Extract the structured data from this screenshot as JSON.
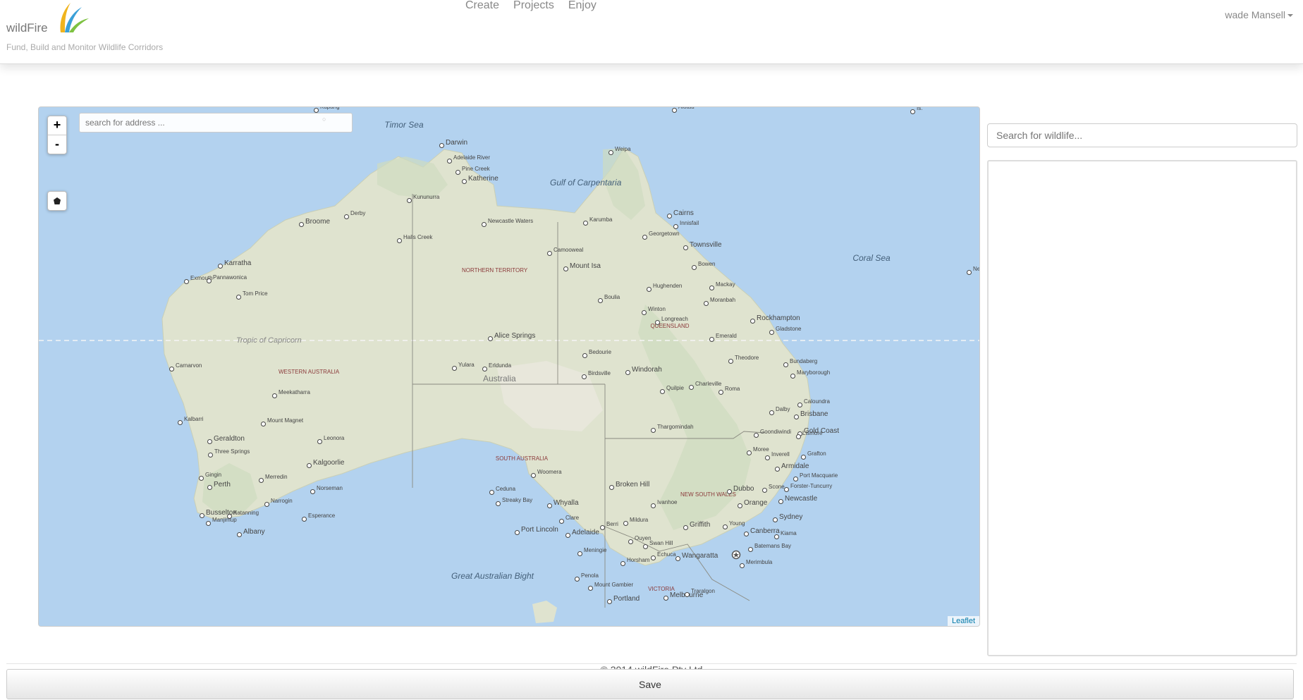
{
  "header": {
    "brand": "wildFire",
    "tagline": "Fund, Build and Monitor Wildlife Corridors",
    "nav": [
      "Create",
      "Projects",
      "Enjoy"
    ],
    "user": "wade Mansell"
  },
  "map": {
    "zoom_in": "+",
    "zoom_out": "-",
    "address_placeholder": "search for address ...",
    "attribution": "Leaflet",
    "country": "Australia",
    "tropic": "Tropic of Capricorn",
    "seas": [
      "Timor Sea",
      "Gulf of Carpentaria",
      "Coral Sea",
      "Great Australian Bight"
    ],
    "states": [
      "NORTHERN TERRITORY",
      "QUEENSLAND",
      "WESTERN AUSTRALIA",
      "SOUTH AUSTRALIA",
      "NEW SOUTH WALES",
      "VICTORIA"
    ],
    "cities": [
      {
        "name": "Darwin",
        "big": true
      },
      {
        "name": "Adelaide River"
      },
      {
        "name": "Pine Creek"
      },
      {
        "name": "Katherine",
        "big": true
      },
      {
        "name": "Kununurra"
      },
      {
        "name": "Derby"
      },
      {
        "name": "Broome",
        "big": true
      },
      {
        "name": "Halls Creek"
      },
      {
        "name": "Newcastle Waters"
      },
      {
        "name": "Karratha",
        "big": true
      },
      {
        "name": "Exmouth"
      },
      {
        "name": "Pannawonica"
      },
      {
        "name": "Tom Price"
      },
      {
        "name": "Camooweal"
      },
      {
        "name": "Mount Isa",
        "big": true
      },
      {
        "name": "Karumba"
      },
      {
        "name": "Weipa"
      },
      {
        "name": "Cairns",
        "big": true
      },
      {
        "name": "Innisfail"
      },
      {
        "name": "Georgetown"
      },
      {
        "name": "Townsville",
        "big": true
      },
      {
        "name": "Bowen"
      },
      {
        "name": "Hughenden"
      },
      {
        "name": "Mackay"
      },
      {
        "name": "Moranbah"
      },
      {
        "name": "Winton"
      },
      {
        "name": "Longreach"
      },
      {
        "name": "Boulia"
      },
      {
        "name": "Emerald"
      },
      {
        "name": "Rockhampton",
        "big": true
      },
      {
        "name": "Gladstone"
      },
      {
        "name": "Alice Springs",
        "big": true
      },
      {
        "name": "Carnarvon"
      },
      {
        "name": "Bedourie"
      },
      {
        "name": "Theodore"
      },
      {
        "name": "Bundaberg"
      },
      {
        "name": "Maryborough"
      },
      {
        "name": "Yulara"
      },
      {
        "name": "Erldunda"
      },
      {
        "name": "Windorah",
        "big": true
      },
      {
        "name": "Birdsville"
      },
      {
        "name": "Charleville"
      },
      {
        "name": "Meekatharra"
      },
      {
        "name": "Quilpie"
      },
      {
        "name": "Roma"
      },
      {
        "name": "Caloundra"
      },
      {
        "name": "Dalby"
      },
      {
        "name": "Brisbane",
        "big": true
      },
      {
        "name": "Kalbarri"
      },
      {
        "name": "Mount Magnet"
      },
      {
        "name": "Gold Coast",
        "big": true
      },
      {
        "name": "Thargomindah"
      },
      {
        "name": "Geraldton",
        "big": true
      },
      {
        "name": "Leonora"
      },
      {
        "name": "Goondiwindi"
      },
      {
        "name": "Lismore"
      },
      {
        "name": "Three Springs"
      },
      {
        "name": "Moree"
      },
      {
        "name": "Inverell"
      },
      {
        "name": "Grafton"
      },
      {
        "name": "Armidale",
        "big": true
      },
      {
        "name": "Kalgoorlie",
        "big": true
      },
      {
        "name": "Woomera"
      },
      {
        "name": "Gingin"
      },
      {
        "name": "Merredin"
      },
      {
        "name": "Port Macquarie"
      },
      {
        "name": "Perth",
        "big": true
      },
      {
        "name": "Broken Hill",
        "big": true
      },
      {
        "name": "Ceduna"
      },
      {
        "name": "Norseman"
      },
      {
        "name": "Dubbo",
        "big": true
      },
      {
        "name": "Scone"
      },
      {
        "name": "Forster-Tuncurry"
      },
      {
        "name": "Streaky Bay"
      },
      {
        "name": "Narrogin"
      },
      {
        "name": "Whyalla",
        "big": true
      },
      {
        "name": "Ivanhoe"
      },
      {
        "name": "Orange",
        "big": true
      },
      {
        "name": "Newcastle",
        "big": true
      },
      {
        "name": "Busselton",
        "big": true
      },
      {
        "name": "Katanning"
      },
      {
        "name": "Esperance"
      },
      {
        "name": "Clare"
      },
      {
        "name": "Sydney",
        "big": true
      },
      {
        "name": "Manjimup"
      },
      {
        "name": "Berri"
      },
      {
        "name": "Mildura"
      },
      {
        "name": "Griffith",
        "big": true
      },
      {
        "name": "Young"
      },
      {
        "name": "Albany",
        "big": true
      },
      {
        "name": "Port Lincoln",
        "big": true
      },
      {
        "name": "Adelaide",
        "big": true
      },
      {
        "name": "Kiama"
      },
      {
        "name": "Ouyen"
      },
      {
        "name": "Canberra",
        "big": true
      },
      {
        "name": "Swan Hill"
      },
      {
        "name": "Batemans Bay"
      },
      {
        "name": "Meningie"
      },
      {
        "name": "Echuca"
      },
      {
        "name": "Wangaratta",
        "big": true
      },
      {
        "name": "Horsham"
      },
      {
        "name": "Merimbula"
      },
      {
        "name": "Penola"
      },
      {
        "name": "Mount Gambier"
      },
      {
        "name": "Melbourne",
        "big": true
      },
      {
        "name": "Portland",
        "big": true
      },
      {
        "name": "Traralgon"
      },
      {
        "name": "Kupang"
      },
      {
        "name": "Alotau"
      },
      {
        "name": "Is."
      },
      {
        "name": "Ne"
      }
    ]
  },
  "sidebar": {
    "search_placeholder": "Search for wildlife..."
  },
  "footer": {
    "copyright": "© 2014 wildFire Pty Ltd",
    "save_label": "Save"
  }
}
